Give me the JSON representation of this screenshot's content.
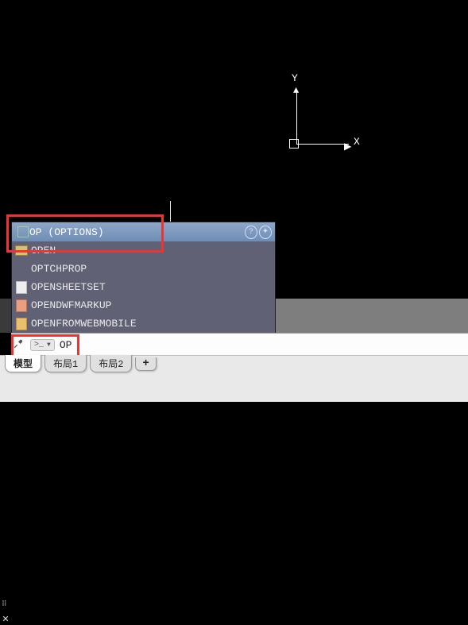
{
  "ucs": {
    "x_label": "X",
    "y_label": "Y"
  },
  "suggestions": {
    "selected": {
      "label": "OP (OPTIONS)"
    },
    "items": [
      {
        "label": "OPEN"
      },
      {
        "label": "OPTCHPROP"
      },
      {
        "label": "OPENSHEETSET"
      },
      {
        "label": "OPENDWFMARKUP"
      },
      {
        "label": "OPENFROMWEBMOBILE"
      }
    ]
  },
  "command_input": {
    "value": "OP",
    "prompt_icon": ">_"
  },
  "tabs": {
    "items": [
      {
        "name": "model",
        "label": "模型",
        "active": true
      },
      {
        "name": "layout1",
        "label": "布局1",
        "active": false
      },
      {
        "name": "layout2",
        "label": "布局2",
        "active": false
      }
    ],
    "plus": "+"
  }
}
